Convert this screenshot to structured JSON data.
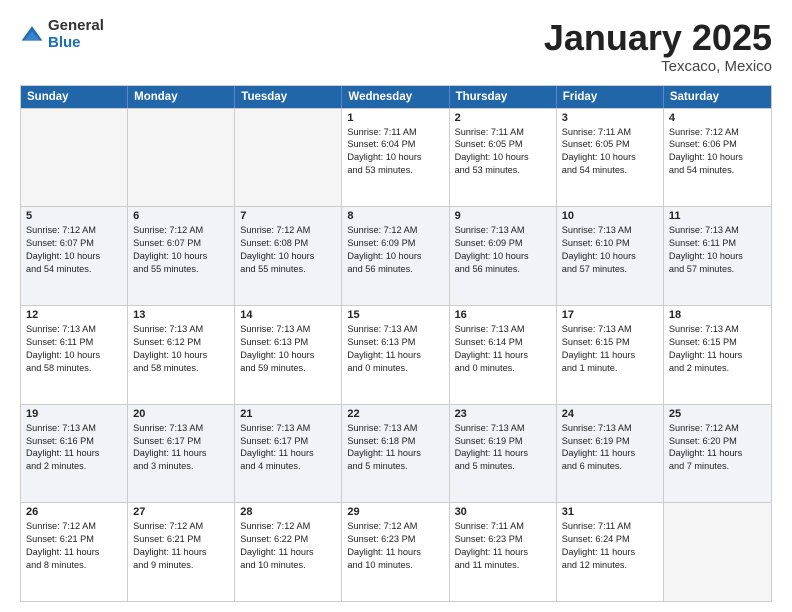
{
  "logo": {
    "general": "General",
    "blue": "Blue"
  },
  "title": {
    "month": "January 2025",
    "location": "Texcaco, Mexico"
  },
  "weekdays": [
    "Sunday",
    "Monday",
    "Tuesday",
    "Wednesday",
    "Thursday",
    "Friday",
    "Saturday"
  ],
  "rows": [
    {
      "alt": false,
      "cells": [
        {
          "day": "",
          "lines": []
        },
        {
          "day": "",
          "lines": []
        },
        {
          "day": "",
          "lines": []
        },
        {
          "day": "1",
          "lines": [
            "Sunrise: 7:11 AM",
            "Sunset: 6:04 PM",
            "Daylight: 10 hours",
            "and 53 minutes."
          ]
        },
        {
          "day": "2",
          "lines": [
            "Sunrise: 7:11 AM",
            "Sunset: 6:05 PM",
            "Daylight: 10 hours",
            "and 53 minutes."
          ]
        },
        {
          "day": "3",
          "lines": [
            "Sunrise: 7:11 AM",
            "Sunset: 6:05 PM",
            "Daylight: 10 hours",
            "and 54 minutes."
          ]
        },
        {
          "day": "4",
          "lines": [
            "Sunrise: 7:12 AM",
            "Sunset: 6:06 PM",
            "Daylight: 10 hours",
            "and 54 minutes."
          ]
        }
      ]
    },
    {
      "alt": true,
      "cells": [
        {
          "day": "5",
          "lines": [
            "Sunrise: 7:12 AM",
            "Sunset: 6:07 PM",
            "Daylight: 10 hours",
            "and 54 minutes."
          ]
        },
        {
          "day": "6",
          "lines": [
            "Sunrise: 7:12 AM",
            "Sunset: 6:07 PM",
            "Daylight: 10 hours",
            "and 55 minutes."
          ]
        },
        {
          "day": "7",
          "lines": [
            "Sunrise: 7:12 AM",
            "Sunset: 6:08 PM",
            "Daylight: 10 hours",
            "and 55 minutes."
          ]
        },
        {
          "day": "8",
          "lines": [
            "Sunrise: 7:12 AM",
            "Sunset: 6:09 PM",
            "Daylight: 10 hours",
            "and 56 minutes."
          ]
        },
        {
          "day": "9",
          "lines": [
            "Sunrise: 7:13 AM",
            "Sunset: 6:09 PM",
            "Daylight: 10 hours",
            "and 56 minutes."
          ]
        },
        {
          "day": "10",
          "lines": [
            "Sunrise: 7:13 AM",
            "Sunset: 6:10 PM",
            "Daylight: 10 hours",
            "and 57 minutes."
          ]
        },
        {
          "day": "11",
          "lines": [
            "Sunrise: 7:13 AM",
            "Sunset: 6:11 PM",
            "Daylight: 10 hours",
            "and 57 minutes."
          ]
        }
      ]
    },
    {
      "alt": false,
      "cells": [
        {
          "day": "12",
          "lines": [
            "Sunrise: 7:13 AM",
            "Sunset: 6:11 PM",
            "Daylight: 10 hours",
            "and 58 minutes."
          ]
        },
        {
          "day": "13",
          "lines": [
            "Sunrise: 7:13 AM",
            "Sunset: 6:12 PM",
            "Daylight: 10 hours",
            "and 58 minutes."
          ]
        },
        {
          "day": "14",
          "lines": [
            "Sunrise: 7:13 AM",
            "Sunset: 6:13 PM",
            "Daylight: 10 hours",
            "and 59 minutes."
          ]
        },
        {
          "day": "15",
          "lines": [
            "Sunrise: 7:13 AM",
            "Sunset: 6:13 PM",
            "Daylight: 11 hours",
            "and 0 minutes."
          ]
        },
        {
          "day": "16",
          "lines": [
            "Sunrise: 7:13 AM",
            "Sunset: 6:14 PM",
            "Daylight: 11 hours",
            "and 0 minutes."
          ]
        },
        {
          "day": "17",
          "lines": [
            "Sunrise: 7:13 AM",
            "Sunset: 6:15 PM",
            "Daylight: 11 hours",
            "and 1 minute."
          ]
        },
        {
          "day": "18",
          "lines": [
            "Sunrise: 7:13 AM",
            "Sunset: 6:15 PM",
            "Daylight: 11 hours",
            "and 2 minutes."
          ]
        }
      ]
    },
    {
      "alt": true,
      "cells": [
        {
          "day": "19",
          "lines": [
            "Sunrise: 7:13 AM",
            "Sunset: 6:16 PM",
            "Daylight: 11 hours",
            "and 2 minutes."
          ]
        },
        {
          "day": "20",
          "lines": [
            "Sunrise: 7:13 AM",
            "Sunset: 6:17 PM",
            "Daylight: 11 hours",
            "and 3 minutes."
          ]
        },
        {
          "day": "21",
          "lines": [
            "Sunrise: 7:13 AM",
            "Sunset: 6:17 PM",
            "Daylight: 11 hours",
            "and 4 minutes."
          ]
        },
        {
          "day": "22",
          "lines": [
            "Sunrise: 7:13 AM",
            "Sunset: 6:18 PM",
            "Daylight: 11 hours",
            "and 5 minutes."
          ]
        },
        {
          "day": "23",
          "lines": [
            "Sunrise: 7:13 AM",
            "Sunset: 6:19 PM",
            "Daylight: 11 hours",
            "and 5 minutes."
          ]
        },
        {
          "day": "24",
          "lines": [
            "Sunrise: 7:13 AM",
            "Sunset: 6:19 PM",
            "Daylight: 11 hours",
            "and 6 minutes."
          ]
        },
        {
          "day": "25",
          "lines": [
            "Sunrise: 7:12 AM",
            "Sunset: 6:20 PM",
            "Daylight: 11 hours",
            "and 7 minutes."
          ]
        }
      ]
    },
    {
      "alt": false,
      "cells": [
        {
          "day": "26",
          "lines": [
            "Sunrise: 7:12 AM",
            "Sunset: 6:21 PM",
            "Daylight: 11 hours",
            "and 8 minutes."
          ]
        },
        {
          "day": "27",
          "lines": [
            "Sunrise: 7:12 AM",
            "Sunset: 6:21 PM",
            "Daylight: 11 hours",
            "and 9 minutes."
          ]
        },
        {
          "day": "28",
          "lines": [
            "Sunrise: 7:12 AM",
            "Sunset: 6:22 PM",
            "Daylight: 11 hours",
            "and 10 minutes."
          ]
        },
        {
          "day": "29",
          "lines": [
            "Sunrise: 7:12 AM",
            "Sunset: 6:23 PM",
            "Daylight: 11 hours",
            "and 10 minutes."
          ]
        },
        {
          "day": "30",
          "lines": [
            "Sunrise: 7:11 AM",
            "Sunset: 6:23 PM",
            "Daylight: 11 hours",
            "and 11 minutes."
          ]
        },
        {
          "day": "31",
          "lines": [
            "Sunrise: 7:11 AM",
            "Sunset: 6:24 PM",
            "Daylight: 11 hours",
            "and 12 minutes."
          ]
        },
        {
          "day": "",
          "lines": []
        }
      ]
    }
  ]
}
